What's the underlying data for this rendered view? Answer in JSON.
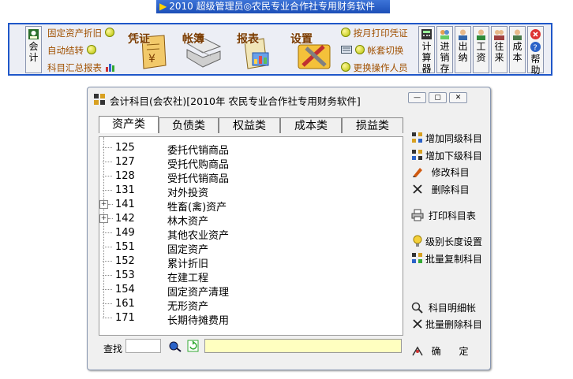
{
  "app": {
    "title": "2010  超级管理员◎农民专业合作社专用财务软件"
  },
  "toolbar": {
    "left_items": [
      {
        "label": "固定资产折旧",
        "icon": "green-dot-icon"
      },
      {
        "label": "自动结转",
        "icon": "green-dot-icon"
      },
      {
        "label": "科目汇总报表",
        "icon": "chart-icon"
      }
    ],
    "first_button": "会计",
    "big_buttons": [
      {
        "label": "凭证",
        "icon": "voucher-icon"
      },
      {
        "label": "帐簿",
        "icon": "ledger-icon"
      },
      {
        "label": "报表",
        "icon": "report-icon"
      },
      {
        "label": "设置",
        "icon": "tools-icon"
      }
    ],
    "right_items": [
      {
        "label": "按月打印凭证",
        "icon": "green-dot-icon"
      },
      {
        "label": "帐套切换",
        "icon": "green-dot-icon"
      },
      {
        "label": "更换操作人员",
        "icon": "green-dot-icon"
      }
    ],
    "vertical_buttons": [
      {
        "label": "计算器",
        "icon": "calculator-icon"
      },
      {
        "label": "进销存",
        "icon": "inventory-icon"
      },
      {
        "label": "出纳",
        "icon": "cashier-icon"
      },
      {
        "label": "工资",
        "icon": "salary-icon"
      },
      {
        "label": "往来",
        "icon": "contacts-icon"
      },
      {
        "label": "成本",
        "icon": "cost-icon"
      },
      {
        "label": "帮助",
        "icon": "help-icon"
      }
    ]
  },
  "dialog": {
    "title": "会计科目(会农社)[2010年 农民专业合作社专用财务软件]",
    "tabs": [
      {
        "label": "资产类",
        "active": true
      },
      {
        "label": "负债类",
        "active": false
      },
      {
        "label": "权益类",
        "active": false
      },
      {
        "label": "成本类",
        "active": false
      },
      {
        "label": "损益类",
        "active": false
      }
    ],
    "accounts": [
      {
        "code": "125",
        "name": "委托代销商品",
        "expandable": false
      },
      {
        "code": "127",
        "name": "受托代购商品",
        "expandable": false
      },
      {
        "code": "128",
        "name": "受托代销商品",
        "expandable": false
      },
      {
        "code": "131",
        "name": "对外投资",
        "expandable": false
      },
      {
        "code": "141",
        "name": "牲畜(禽)资产",
        "expandable": true
      },
      {
        "code": "142",
        "name": "林木资产",
        "expandable": true
      },
      {
        "code": "149",
        "name": "其他农业资产",
        "expandable": false
      },
      {
        "code": "151",
        "name": "固定资产",
        "expandable": false
      },
      {
        "code": "152",
        "name": "累计折旧",
        "expandable": false
      },
      {
        "code": "153",
        "name": "在建工程",
        "expandable": false
      },
      {
        "code": "154",
        "name": "固定资产清理",
        "expandable": false
      },
      {
        "code": "161",
        "name": "无形资产",
        "expandable": false
      },
      {
        "code": "171",
        "name": "长期待摊费用",
        "expandable": false
      }
    ],
    "actions": [
      {
        "label": "增加同级科目",
        "icon": "add-sibling-icon"
      },
      {
        "label": "增加下级科目",
        "icon": "add-child-icon"
      },
      {
        "label": "修改科目",
        "icon": "edit-icon"
      },
      {
        "label": "删除科目",
        "icon": "delete-icon"
      },
      {
        "label": "打印科目表",
        "icon": "printer-icon"
      },
      {
        "label": "级别长度设置",
        "icon": "bulb-icon"
      },
      {
        "label": "批量复制科目",
        "icon": "copy-icon"
      },
      {
        "label": "科目明细帐",
        "icon": "detail-icon"
      },
      {
        "label": "批量删除科目",
        "icon": "batch-delete-icon"
      }
    ],
    "search_label": "查找",
    "search_value": "",
    "confirm_label": "确      定"
  },
  "colors": {
    "title_bar": "#1c4fb8",
    "toolbar_border": "#1f57c9",
    "toolbar_bg": "#eceef5",
    "highlight_field": "#ffffc0"
  }
}
